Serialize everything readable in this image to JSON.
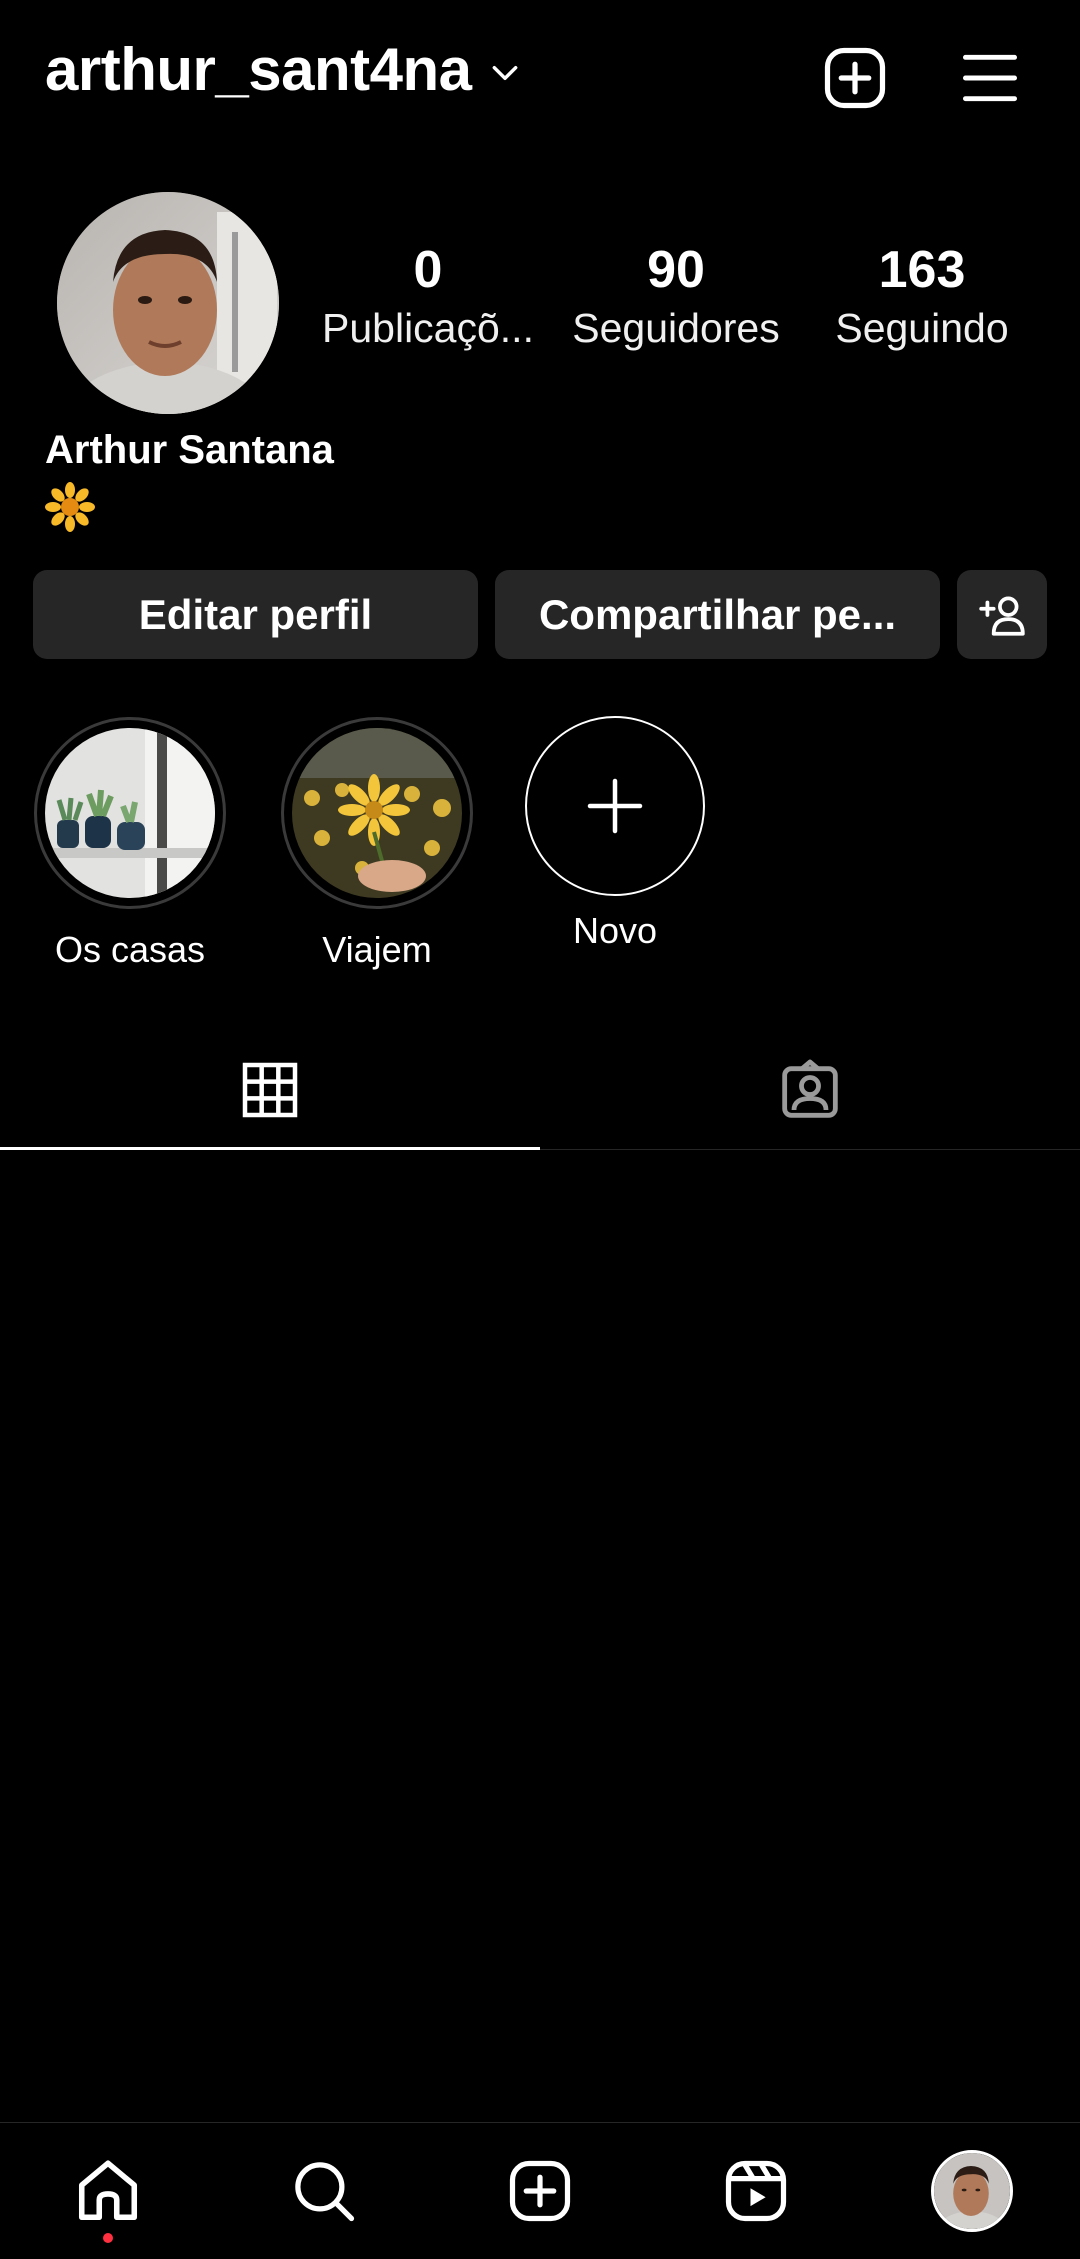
{
  "header": {
    "username": "arthur_sant4na",
    "icons": {
      "dropdown": "chevron-down-icon",
      "create": "plus-square-icon",
      "menu": "hamburger-menu-icon"
    }
  },
  "profile": {
    "full_name": "Arthur Santana",
    "bio_emoji": "sunflower-emoji",
    "stats": [
      {
        "value": "0",
        "label": "Publicaçõ..."
      },
      {
        "value": "90",
        "label": "Seguidores"
      },
      {
        "value": "163",
        "label": "Seguindo"
      }
    ]
  },
  "actions": {
    "edit_label": "Editar perfil",
    "share_label": "Compartilhar pe...",
    "add_user_icon": "add-person-icon"
  },
  "highlights": [
    {
      "label": "Os casas"
    },
    {
      "label": "Viajem"
    },
    {
      "label": "Novo"
    }
  ],
  "tabs": [
    {
      "name": "grid",
      "icon": "grid-icon",
      "active": true
    },
    {
      "name": "tagged",
      "icon": "tagged-person-icon",
      "active": false
    }
  ],
  "bottom_nav": [
    {
      "name": "home",
      "icon": "home-icon",
      "has_notification": true
    },
    {
      "name": "search",
      "icon": "search-icon"
    },
    {
      "name": "create",
      "icon": "plus-square-icon"
    },
    {
      "name": "reels",
      "icon": "reels-icon"
    },
    {
      "name": "profile",
      "icon": "avatar"
    }
  ],
  "colors": {
    "background": "#000000",
    "button_bg": "#262626",
    "text": "#ffffff",
    "notification": "#ff3040"
  }
}
